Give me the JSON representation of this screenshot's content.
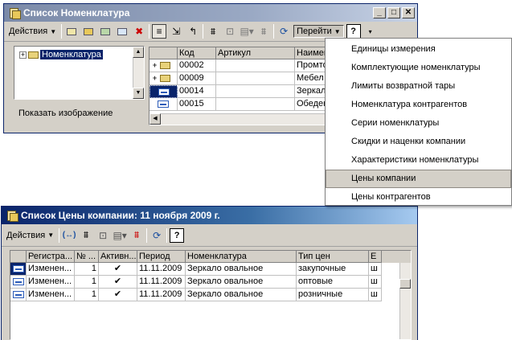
{
  "window1": {
    "title": "Список Номенклатура",
    "toolbar": {
      "actions_label": "Действия",
      "goto_label": "Перейти",
      "help_label": "?"
    },
    "tree": {
      "root_label": "Номенклатура"
    },
    "show_image_label": "Показать изображение",
    "table": {
      "columns": [
        "Код",
        "Артикул",
        "Наимен"
      ],
      "rows": [
        {
          "code": "00002",
          "article": "",
          "name": "Промто"
        },
        {
          "code": "00009",
          "article": "",
          "name": "Мебел"
        },
        {
          "code": "00014",
          "article": "",
          "name": "Зеркал"
        },
        {
          "code": "00015",
          "article": "",
          "name": "Обеден"
        }
      ]
    }
  },
  "goto_menu": {
    "items": [
      "Единицы измерения",
      "Комплектующие номенклатуры",
      "Лимиты возвратной тары",
      "Номенклатура контрагентов",
      "Серии номенклатуры",
      "Скидки и наценки компании",
      "Характеристики номенклатуры",
      "Цены компании",
      "Цены контрагентов"
    ],
    "highlighted_index": 7
  },
  "window2": {
    "title": "Список Цены компании: 11 ноября 2009 г.",
    "toolbar": {
      "actions_label": "Действия",
      "help_label": "?"
    },
    "table": {
      "columns": [
        "Регистра...",
        "№ ...",
        "Активн...",
        "Период",
        "Номенклатура",
        "Тип цен",
        "Е"
      ],
      "rows": [
        {
          "registrar": "Изменен...",
          "no": "1",
          "active": "✔",
          "period": "11.11.2009",
          "item": "Зеркало овальное",
          "price_type": "закупочные",
          "unit": "ш"
        },
        {
          "registrar": "Изменен...",
          "no": "1",
          "active": "✔",
          "period": "11.11.2009",
          "item": "Зеркало овальное",
          "price_type": "оптовые",
          "unit": "ш"
        },
        {
          "registrar": "Изменен...",
          "no": "1",
          "active": "✔",
          "period": "11.11.2009",
          "item": "Зеркало овальное",
          "price_type": "розничные",
          "unit": "ш"
        }
      ]
    }
  },
  "colors": {
    "title_active": "#0a246a",
    "title_inactive": "#7b8aa8",
    "face": "#d4d0c8",
    "selection": "#0a246a"
  }
}
